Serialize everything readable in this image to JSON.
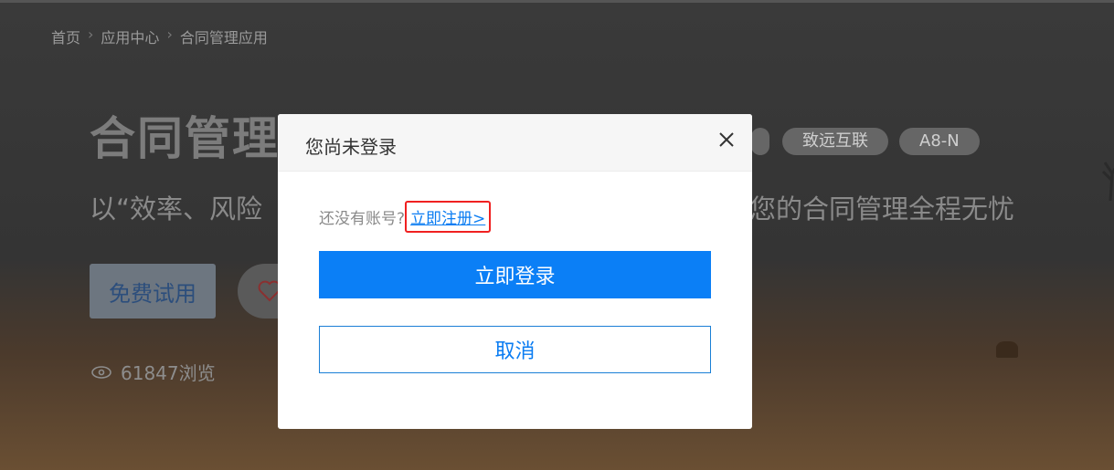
{
  "breadcrumb": {
    "home": "首页",
    "apps": "应用中心",
    "current": "合同管理应用"
  },
  "hero": {
    "title": "合同管理",
    "tags": [
      "致远互联",
      "A8-N"
    ],
    "subtitle_left": "以“效率、风险",
    "subtitle_right": "您的合同管理全程无忧",
    "trial_label": "免费试用",
    "views": "61847浏览"
  },
  "modal": {
    "title": "您尚未登录",
    "no_account_text": "还没有账号?",
    "register_link": "立即注册>",
    "login_label": "立即登录",
    "cancel_label": "取消"
  },
  "colors": {
    "accent": "#0b7ff6",
    "highlight": "#f02020"
  }
}
